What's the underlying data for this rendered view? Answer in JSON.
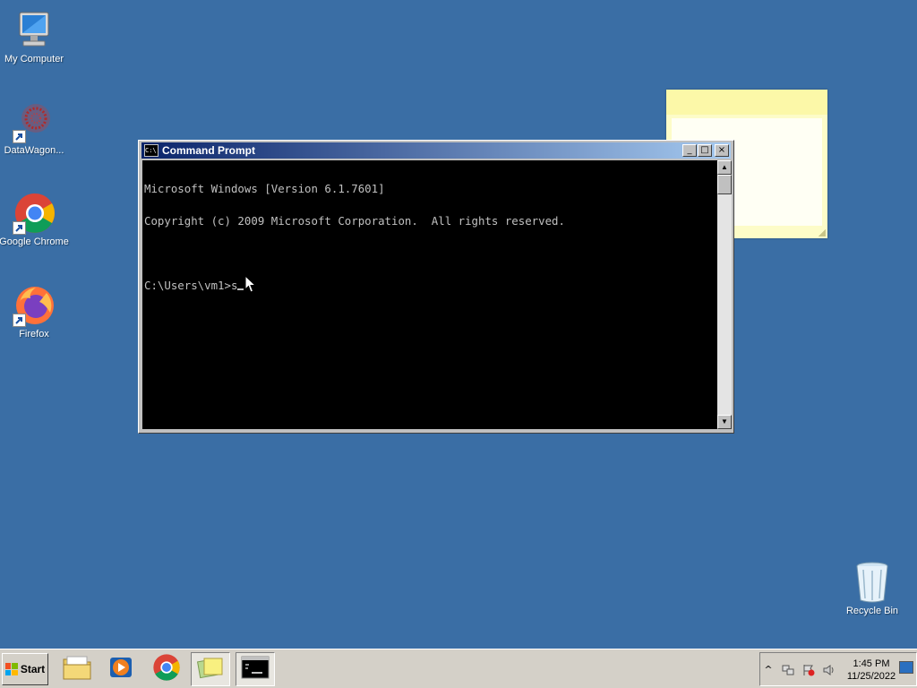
{
  "desktop": {
    "icons": [
      {
        "label": "My Computer"
      },
      {
        "label": "DataWagon..."
      },
      {
        "label": "Google Chrome"
      },
      {
        "label": "Firefox"
      },
      {
        "label": "Recycle Bin"
      }
    ]
  },
  "cmd_window": {
    "title": "Command Prompt",
    "icon_text": "C:\\",
    "buttons": {
      "minimize": "_",
      "maximize": "□",
      "close": "×"
    },
    "lines": [
      "Microsoft Windows [Version 6.1.7601]",
      "Copyright (c) 2009 Microsoft Corporation.  All rights reserved.",
      ""
    ],
    "prompt": "C:\\Users\\vm1>",
    "input": "s"
  },
  "taskbar": {
    "start_label": "Start",
    "items": [
      {
        "name": "windows-explorer",
        "active": false
      },
      {
        "name": "media-player",
        "active": false
      },
      {
        "name": "google-chrome",
        "active": false
      },
      {
        "name": "sticky-notes",
        "active": true
      },
      {
        "name": "command-prompt",
        "active": true
      }
    ],
    "tray": {
      "time": "1:45 PM",
      "date": "11/25/2022",
      "show_hidden": "^"
    }
  },
  "colors": {
    "desktop": "#3a6ea5",
    "titlebar_start": "#0a246a",
    "titlebar_end": "#a6caf0",
    "console_bg": "#000000",
    "console_fg": "#c0c0c0"
  }
}
